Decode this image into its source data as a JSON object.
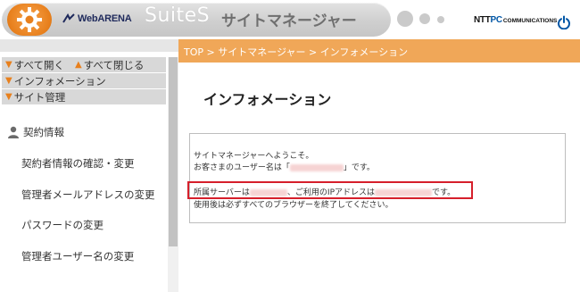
{
  "header": {
    "brand": "WebARENA",
    "suite_name": "SuiteS",
    "suite_sub": "サイトマネージャー",
    "company_main": "NTT",
    "company_pc": "PC",
    "company_comm": "COMMUNICATIONS",
    "colors": {
      "accent_orange": "#e8801d",
      "header_gray": "#cfcfcf",
      "brand_blue": "#0056a6"
    }
  },
  "sidebar": {
    "expand_all": "すべて開く",
    "collapse_all": "すべて閉じる",
    "group_info": "インフォメーション",
    "group_site": "サイト管理",
    "section_title": "契約情報",
    "links": [
      "契約者情報の確認・変更",
      "管理者メールアドレスの変更",
      "パスワードの変更",
      "管理者ユーザー名の変更"
    ]
  },
  "breadcrumb": {
    "top": "TOP",
    "sep": " > ",
    "site_manager": "サイトマネージャー",
    "current": "インフォメーション"
  },
  "main": {
    "title": "インフォメーション",
    "welcome": "サイトマネージャーへようこそ。",
    "username_prefix": "お客さまのユーザー名は「",
    "username_suffix": "」です。",
    "server_prefix": "所属サーバーは",
    "server_mid": "、ご利用のIPアドレスは",
    "server_suffix": "です。",
    "closing_note": "使用後は必ずすべてのブラウザーを終了してください。"
  }
}
